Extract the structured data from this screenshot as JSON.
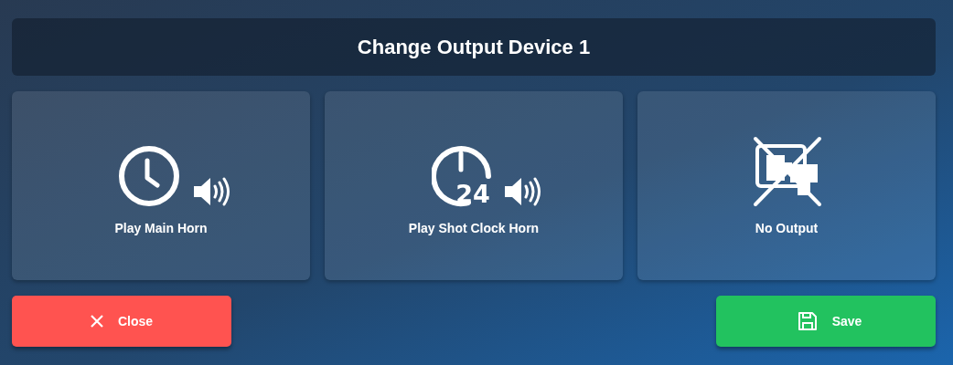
{
  "dialog": {
    "title": "Change Output Device 1"
  },
  "options": [
    {
      "kind": "main_horn",
      "label": "Play Main Horn"
    },
    {
      "kind": "shot_clock_horn",
      "label": "Play Shot Clock Horn",
      "icon_text": "24"
    },
    {
      "kind": "none",
      "label": "No Output"
    }
  ],
  "buttons": [
    {
      "kind": "close",
      "label": "Close"
    },
    {
      "kind": "save",
      "label": "Save"
    }
  ]
}
